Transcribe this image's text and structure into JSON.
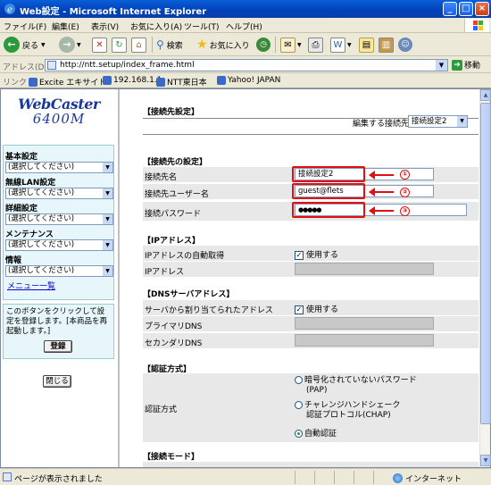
{
  "window": {
    "title": "Web設定 - Microsoft Internet Explorer"
  },
  "menubar": [
    "ファイル(F)",
    "編集(E)",
    "表示(V)",
    "お気に入り(A)",
    "ツール(T)",
    "ヘルプ(H)"
  ],
  "toolbar": {
    "back": "戻る",
    "search": "検索",
    "favorites": "お気に入り"
  },
  "address": {
    "label": "アドレス(D)",
    "url": "http://ntt.setup/index_frame.html",
    "go": "移動"
  },
  "links": {
    "label": "リンク",
    "items": [
      "Excite エキサイト",
      "192.168.1.1",
      "NTT東日本",
      "Yahoo! JAPAN"
    ]
  },
  "left": {
    "logo_line1": "WebCaster",
    "logo_line2": "6400M",
    "groups": [
      {
        "heading": "基本設定",
        "value": "(選択してください)"
      },
      {
        "heading": "無線LAN設定",
        "value": "(選択してください)"
      },
      {
        "heading": "詳細設定",
        "value": "(選択してください)"
      },
      {
        "heading": "メンテナンス",
        "value": "(選択してください)"
      },
      {
        "heading": "情報",
        "value": "(選択してください)"
      }
    ],
    "menu_list": "メニュー一覧",
    "note": "このボタンをクリックして設定を登録します。[本商品を再起動します。]",
    "register": "登録",
    "close": "閉じる"
  },
  "right": {
    "page_heading": "【接続先設定】",
    "edit_label": "編集する接続先",
    "edit_value": "接続設定2",
    "conn": {
      "heading": "【接続先の設定】",
      "name_label": "接続先名",
      "name_value": "接続設定2",
      "user_label": "接続先ユーザー名",
      "user_value": "guest@flets",
      "pass_label": "接続パスワード",
      "pass_value": "●●●●●",
      "marks": [
        "①",
        "②",
        "③"
      ]
    },
    "ip": {
      "heading": "【IPアドレス】",
      "auto_label": "IPアドレスの自動取得",
      "use_label": "使用する",
      "ip_label": "IPアドレス"
    },
    "dns": {
      "heading": "【DNSサーバアドレス】",
      "auto_label": "サーバから割り当てられたアドレス",
      "use_label": "使用する",
      "primary_label": "プライマリDNS",
      "secondary_label": "セカンダリDNS"
    },
    "auth": {
      "heading": "【認証方式】",
      "label": "認証方式",
      "opt1_line1": "暗号化されていないパスワード",
      "opt1_line2": "(PAP)",
      "opt2_line1": "チャレンジハンドシェーク",
      "opt2_line2": "認証プロトコル(CHAP)",
      "opt3": "自動認証"
    },
    "mode": {
      "heading": "【接続モード】"
    }
  },
  "status": {
    "message": "ページが表示されました",
    "zone": "インターネット"
  }
}
